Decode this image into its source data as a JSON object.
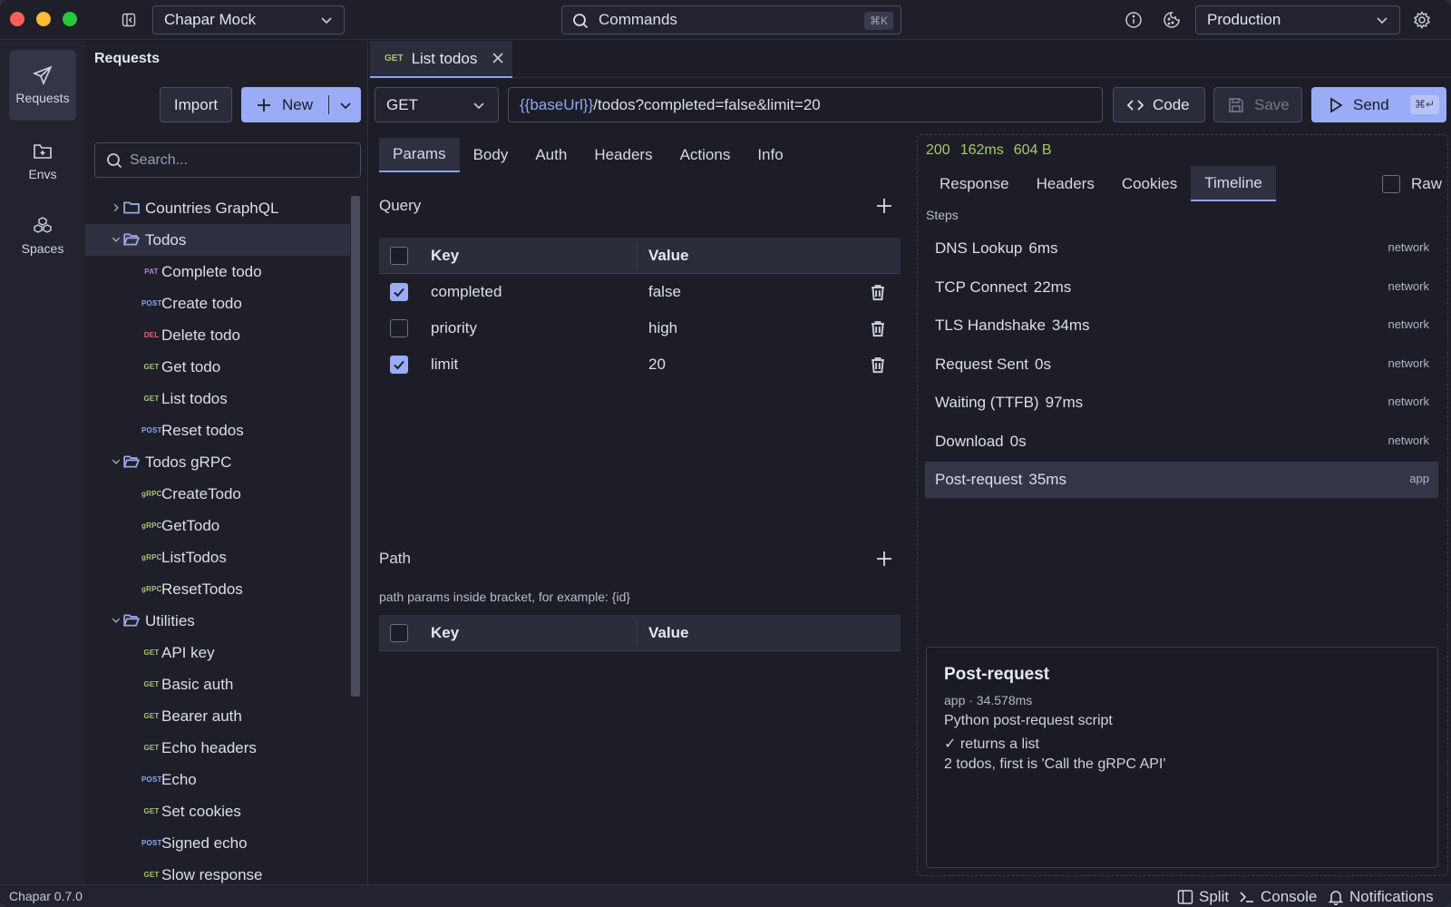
{
  "titlebar": {
    "workspace": "Chapar Mock",
    "commands_label": "Commands",
    "commands_shortcut": "⌘K",
    "environment": "Production"
  },
  "rail": {
    "requests": "Requests",
    "envs": "Envs",
    "spaces": "Spaces"
  },
  "explorer": {
    "title": "Requests",
    "import_label": "Import",
    "new_label": "New",
    "search_placeholder": "Search...",
    "tree": [
      {
        "type": "folder",
        "label": "Countries GraphQL",
        "expanded": false,
        "level": 0
      },
      {
        "type": "folder",
        "label": "Todos",
        "expanded": true,
        "level": 0,
        "selected": true
      },
      {
        "type": "request",
        "method": "PAT",
        "label": "Complete todo"
      },
      {
        "type": "request",
        "method": "POST",
        "label": "Create todo"
      },
      {
        "type": "request",
        "method": "DEL",
        "label": "Delete todo"
      },
      {
        "type": "request",
        "method": "GET",
        "label": "Get todo"
      },
      {
        "type": "request",
        "method": "GET",
        "label": "List todos"
      },
      {
        "type": "request",
        "method": "POST",
        "label": "Reset todos"
      },
      {
        "type": "folder",
        "label": "Todos gRPC",
        "expanded": true,
        "level": 0
      },
      {
        "type": "request",
        "method": "gRPC",
        "label": "CreateTodo"
      },
      {
        "type": "request",
        "method": "gRPC",
        "label": "GetTodo"
      },
      {
        "type": "request",
        "method": "gRPC",
        "label": "ListTodos"
      },
      {
        "type": "request",
        "method": "gRPC",
        "label": "ResetTodos"
      },
      {
        "type": "folder",
        "label": "Utilities",
        "expanded": true,
        "level": 0
      },
      {
        "type": "request",
        "method": "GET",
        "label": "API key"
      },
      {
        "type": "request",
        "method": "GET",
        "label": "Basic auth"
      },
      {
        "type": "request",
        "method": "GET",
        "label": "Bearer auth"
      },
      {
        "type": "request",
        "method": "GET",
        "label": "Echo headers"
      },
      {
        "type": "request",
        "method": "POST",
        "label": "Echo"
      },
      {
        "type": "request",
        "method": "GET",
        "label": "Set cookies"
      },
      {
        "type": "request",
        "method": "POST",
        "label": "Signed echo"
      },
      {
        "type": "request",
        "method": "GET",
        "label": "Slow response"
      }
    ],
    "method_colors": {
      "GET": "#a8c776",
      "POST": "#8fa6f5",
      "DEL": "#e06c75",
      "PAT": "#b77fd6",
      "gRPC": "#a8c776"
    }
  },
  "tab": {
    "method": "GET",
    "title": "List todos"
  },
  "request": {
    "method": "GET",
    "url_var": "{{baseUrl}}",
    "url_rest": "/todos?completed=false&limit=20",
    "code_label": "Code",
    "save_label": "Save",
    "send_label": "Send",
    "send_shortcut": "⌘↵",
    "tabs": [
      "Params",
      "Body",
      "Auth",
      "Headers",
      "Actions",
      "Info"
    ],
    "active_tab": "Params"
  },
  "params": {
    "query_title": "Query",
    "key_header": "Key",
    "value_header": "Value",
    "query": [
      {
        "enabled": true,
        "key": "completed",
        "value": "false"
      },
      {
        "enabled": false,
        "key": "priority",
        "value": "high"
      },
      {
        "enabled": true,
        "key": "limit",
        "value": "20"
      }
    ],
    "path_title": "Path",
    "path_hint": "path params inside bracket, for example: {id}"
  },
  "response": {
    "status": "200",
    "time": "162ms",
    "size": "604 B",
    "tabs": [
      "Response",
      "Headers",
      "Cookies",
      "Timeline"
    ],
    "active_tab": "Timeline",
    "raw_label": "Raw",
    "steps_label": "Steps",
    "steps": [
      {
        "name": "DNS Lookup",
        "duration": "6ms",
        "category": "network"
      },
      {
        "name": "TCP Connect",
        "duration": "22ms",
        "category": "network"
      },
      {
        "name": "TLS Handshake",
        "duration": "34ms",
        "category": "network"
      },
      {
        "name": "Request Sent",
        "duration": "0s",
        "category": "network"
      },
      {
        "name": "Waiting (TTFB)",
        "duration": "97ms",
        "category": "network"
      },
      {
        "name": "Download",
        "duration": "0s",
        "category": "network"
      },
      {
        "name": "Post-request",
        "duration": "35ms",
        "category": "app",
        "selected": true
      }
    ],
    "detail": {
      "title": "Post-request",
      "meta": "app · 34.578ms",
      "line1": "Python post-request script",
      "line2": "✓ returns a list",
      "line3": "2 todos, first is 'Call the gRPC API'"
    }
  },
  "footer": {
    "version": "Chapar 0.7.0",
    "split": "Split",
    "console": "Console",
    "notifications": "Notifications"
  }
}
